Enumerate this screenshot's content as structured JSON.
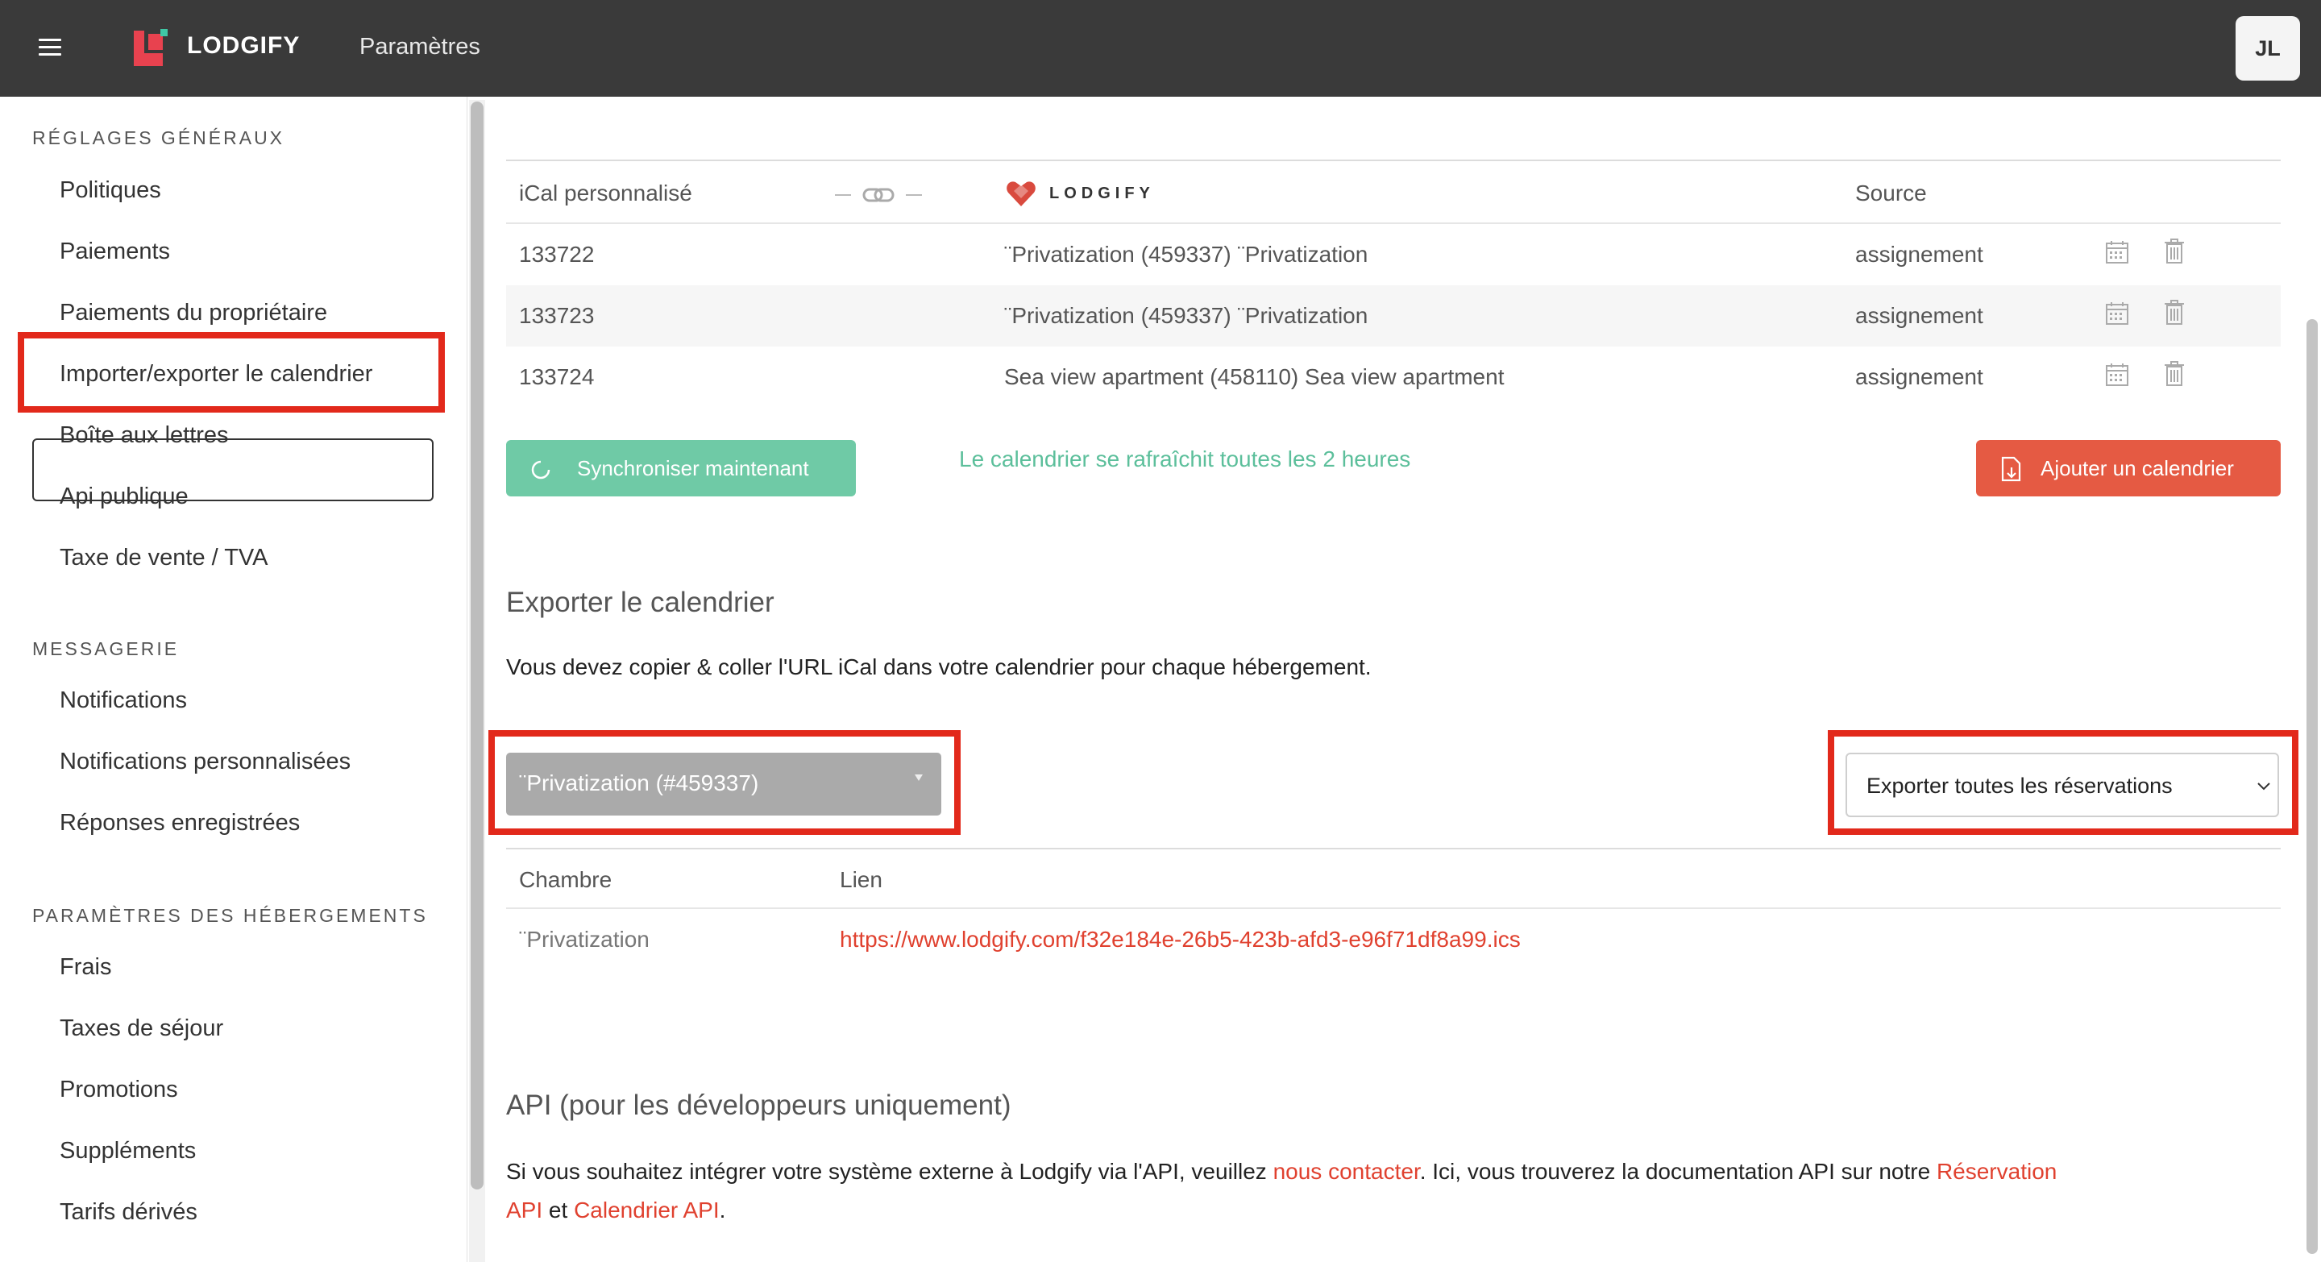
{
  "header": {
    "app_name": "LODGIFY",
    "page_title": "Paramètres",
    "avatar_initials": "JL"
  },
  "sidebar": {
    "sections": [
      {
        "heading": "RÉGLAGES GÉNÉRAUX",
        "items": [
          "Politiques",
          "Paiements",
          "Paiements du propriétaire",
          "Importer/exporter le calendrier",
          "Boîte aux lettres",
          "Api publique",
          "Taxe de vente / TVA"
        ]
      },
      {
        "heading": "MESSAGERIE",
        "items": [
          "Notifications",
          "Notifications personnalisées",
          "Réponses enregistrées"
        ]
      },
      {
        "heading": "PARAMÈTRES DES HÉBERGEMENTS",
        "items": [
          "Frais",
          "Taxes de séjour",
          "Promotions",
          "Suppléments",
          "Tarifs dérivés"
        ]
      }
    ],
    "active_item": "Importer/exporter le calendrier"
  },
  "import_table": {
    "headers": {
      "ical": "iCal personnalisé",
      "lodgify_logo": "LODGIFY",
      "source": "Source"
    },
    "rows": [
      {
        "id": "133722",
        "property": "¨Privatization (459337) ¨Privatization",
        "source": "assignement"
      },
      {
        "id": "133723",
        "property": "¨Privatization (459337) ¨Privatization",
        "source": "assignement"
      },
      {
        "id": "133724",
        "property": "Sea view apartment (458110) Sea view apartment",
        "source": "assignement"
      }
    ]
  },
  "actions": {
    "sync_label": "Synchroniser maintenant",
    "refresh_note": "Le calendrier se rafraîchit toutes les 2 heures",
    "add_label": "Ajouter un calendrier"
  },
  "export": {
    "title": "Exporter le calendrier",
    "description": "Vous devez copier & coller l'URL iCal dans votre calendrier pour chaque hébergement.",
    "room_select_value": "¨Privatization (#459337)",
    "export_select_value": "Exporter toutes les réservations",
    "table_headers": {
      "room": "Chambre",
      "link": "Lien"
    },
    "row": {
      "room": "¨Privatization",
      "link": "https://www.lodgify.com/f32e184e-26b5-423b-afd3-e96f71df8a99.ics"
    }
  },
  "api": {
    "title": "API (pour les développeurs uniquement)",
    "text_1": "Si vous souhaitez intégrer votre système externe à Lodgify via l'API, veuillez ",
    "link_contact": "nous contacter",
    "text_2": ". Ici, vous trouverez la documentation API sur notre ",
    "link_reservation_1": "Réservation",
    "link_reservation_2": "API",
    "text_3": " et ",
    "link_calendar": "Calendrier API",
    "text_4": "."
  },
  "colors": {
    "topbar": "#3a3a3a",
    "accent_green": "#6fcaa6",
    "accent_red": "#e55a43",
    "link_red": "#e0412f",
    "highlight": "#e2291b"
  }
}
